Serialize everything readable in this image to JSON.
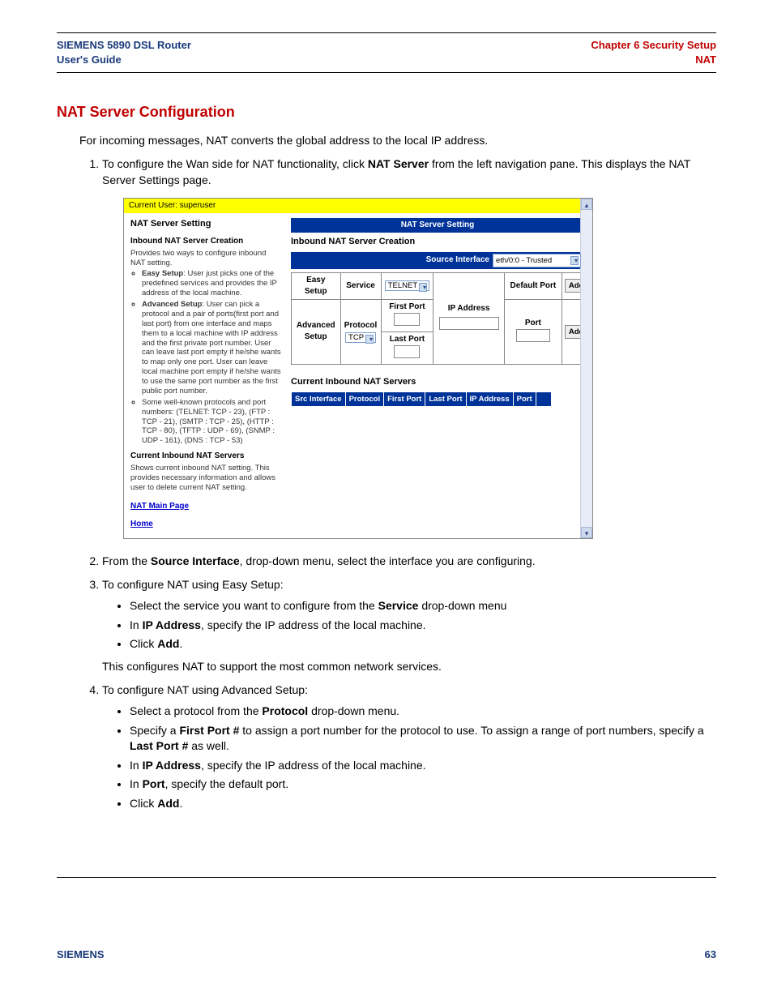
{
  "header": {
    "left_line1": "SIEMENS 5890 DSL Router",
    "left_line2": "User's Guide",
    "right_line1": "Chapter 6  Security Setup",
    "right_line2": "NAT"
  },
  "section_title": "NAT Server Configuration",
  "intro": "For incoming messages, NAT converts the global address to the local IP address.",
  "steps": {
    "s1_pre": "To configure the Wan side for NAT functionality, click ",
    "s1_bold": "NAT Server",
    "s1_post": " from the left navigation pane. This displays the NAT Server Settings page.",
    "s2_pre": "From the ",
    "s2_bold": "Source Interface",
    "s2_post": ", drop-down menu, select the interface you are configuring.",
    "s3": "To configure NAT using Easy Setup:",
    "s3a_pre": "Select the service you want to configure from the ",
    "s3a_bold": "Service",
    "s3a_post": " drop-down menu",
    "s3b_pre": "In ",
    "s3b_bold": "IP Address",
    "s3b_post": ", specify the IP address of the local machine.",
    "s3c_pre": "Click ",
    "s3c_bold": "Add",
    "s3c_post": ".",
    "s3_note": "This configures NAT to support the most common network services.",
    "s4": "To configure NAT using Advanced Setup:",
    "s4a_pre": "Select a protocol from the ",
    "s4a_bold": "Protocol",
    "s4a_post": " drop-down menu.",
    "s4b_pre": "Specify a ",
    "s4b_bold1": "First Port #",
    "s4b_mid": " to assign a port number for the protocol to use. To assign a range of port numbers, specify a ",
    "s4b_bold2": "Last Port #",
    "s4b_post": " as well.",
    "s4c_pre": "In ",
    "s4c_bold": "IP Address",
    "s4c_post": ", specify the IP address of the local machine.",
    "s4d_pre": "In ",
    "s4d_bold": "Port",
    "s4d_post": ", specify the default port.",
    "s4e_pre": "Click ",
    "s4e_bold": "Add",
    "s4e_post": "."
  },
  "shot": {
    "user_bar": "Current User: superuser",
    "left": {
      "title": "NAT Server Setting",
      "sub1_title": "Inbound NAT Server Creation",
      "sub1_desc": "Provides two ways to configure inbound NAT setting.",
      "bullet_easy_label": "Easy Setup",
      "bullet_easy_text": ": User just picks one of the predefined services and provides the IP address of the local machine.",
      "bullet_adv_label": "Advanced Setup",
      "bullet_adv_text": ": User can pick a protocol and a pair of ports(first port and last port) from one interface and maps them to a local machine with IP address and the first private port number. User can leave last port empty if he/she wants to map only one port. User can leave local machine port empty if he/she wants to use the same port number as the first public port number.",
      "bullet_proto_text": "Some well-known protocols and port numbers: (TELNET: TCP - 23), (FTP : TCP - 21), (SMTP : TCP - 25), (HTTP : TCP - 80), (TFTP : UDP - 69), (SNMP : UDP - 161), (DNS : TCP - 53)",
      "sub2_title": "Current Inbound NAT Servers",
      "sub2_desc": "Shows current inbound NAT setting. This provides necessary information and allows user to delete current NAT setting.",
      "link1": "NAT Main Page",
      "link2": "Home"
    },
    "right": {
      "banner": "NAT Server Setting",
      "h_inbound": "Inbound NAT Server Creation",
      "src_label": "Source Interface",
      "src_value": "eth/0:0 - Trusted",
      "easy_label": "Easy Setup",
      "service_label": "Service",
      "service_value": "TELNET",
      "ip_label": "IP Address",
      "defport_label": "Default Port",
      "add_label": "Add",
      "adv_label": "Advanced Setup",
      "protocol_label": "Protocol",
      "protocol_value": "TCP",
      "firstport_label": "First Port",
      "lastport_label": "Last Port",
      "port_label": "Port",
      "h_current": "Current Inbound NAT Servers",
      "cols": {
        "c1": "Src Interface",
        "c2": "Protocol",
        "c3": "First Port",
        "c4": "Last Port",
        "c5": "IP Address",
        "c6": "Port"
      }
    }
  },
  "footer": {
    "brand": "SIEMENS",
    "page": "63"
  }
}
